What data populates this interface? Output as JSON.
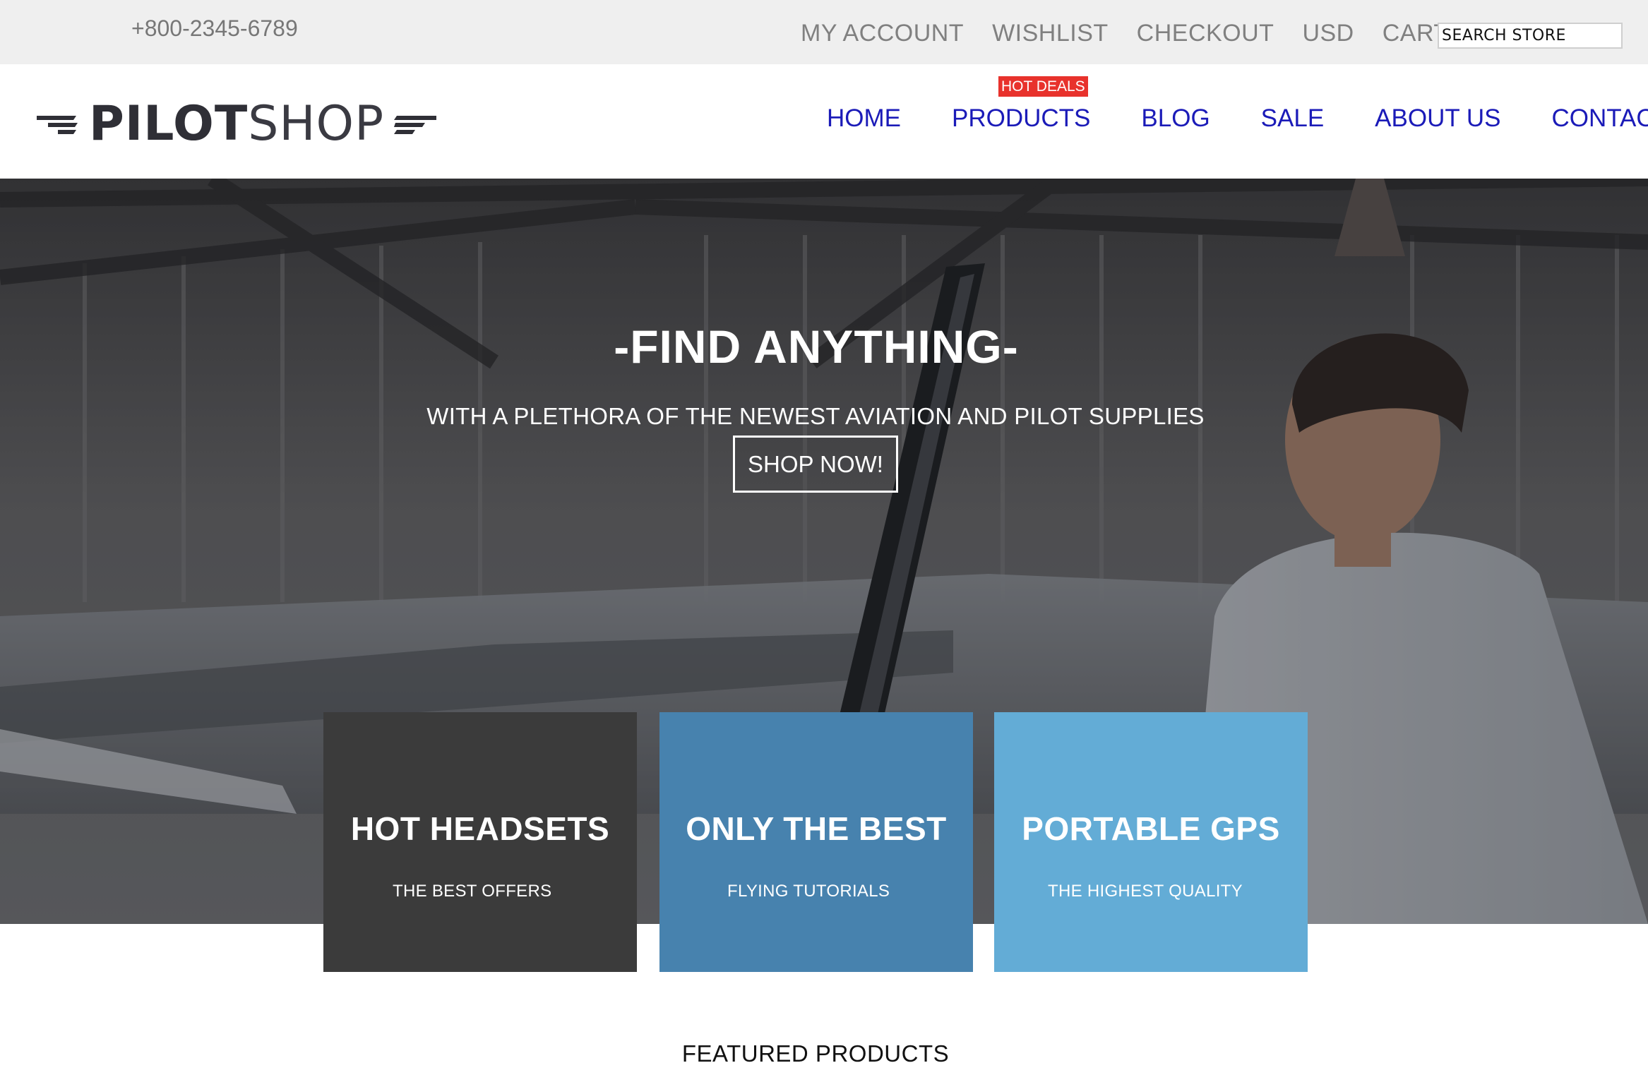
{
  "topbar": {
    "phone": "+800-2345-6789",
    "links": [
      "MY ACCOUNT",
      "WISHLIST",
      "CHECKOUT",
      "USD",
      "CART"
    ],
    "search_placeholder": "SEARCH STORE"
  },
  "header": {
    "logo_bold": "PILOT",
    "logo_light": "SHOP",
    "badge": "HOT DEALS",
    "nav": [
      "HOME",
      "PRODUCTS",
      "BLOG",
      "SALE",
      "ABOUT US",
      "CONTACT US"
    ]
  },
  "hero": {
    "title": "-FIND ANYTHING-",
    "subtitle": "WITH A PLETHORA OF THE NEWEST AVIATION AND PILOT SUPPLIES",
    "button": "SHOP NOW!"
  },
  "tiles": [
    {
      "title": "HOT HEADSETS",
      "subtitle": "THE BEST OFFERS",
      "color": "#3b3b3b"
    },
    {
      "title": "ONLY THE BEST",
      "subtitle": "FLYING TUTORIALS",
      "color": "#4782ae"
    },
    {
      "title": "PORTABLE GPS",
      "subtitle": "THE HIGHEST QUALITY",
      "color": "#63acd6"
    }
  ],
  "featured_heading": "FEATURED PRODUCTS",
  "colors": {
    "nav_link": "#1b1bb8",
    "badge": "#e8322c",
    "topbar_bg": "#efefef"
  }
}
